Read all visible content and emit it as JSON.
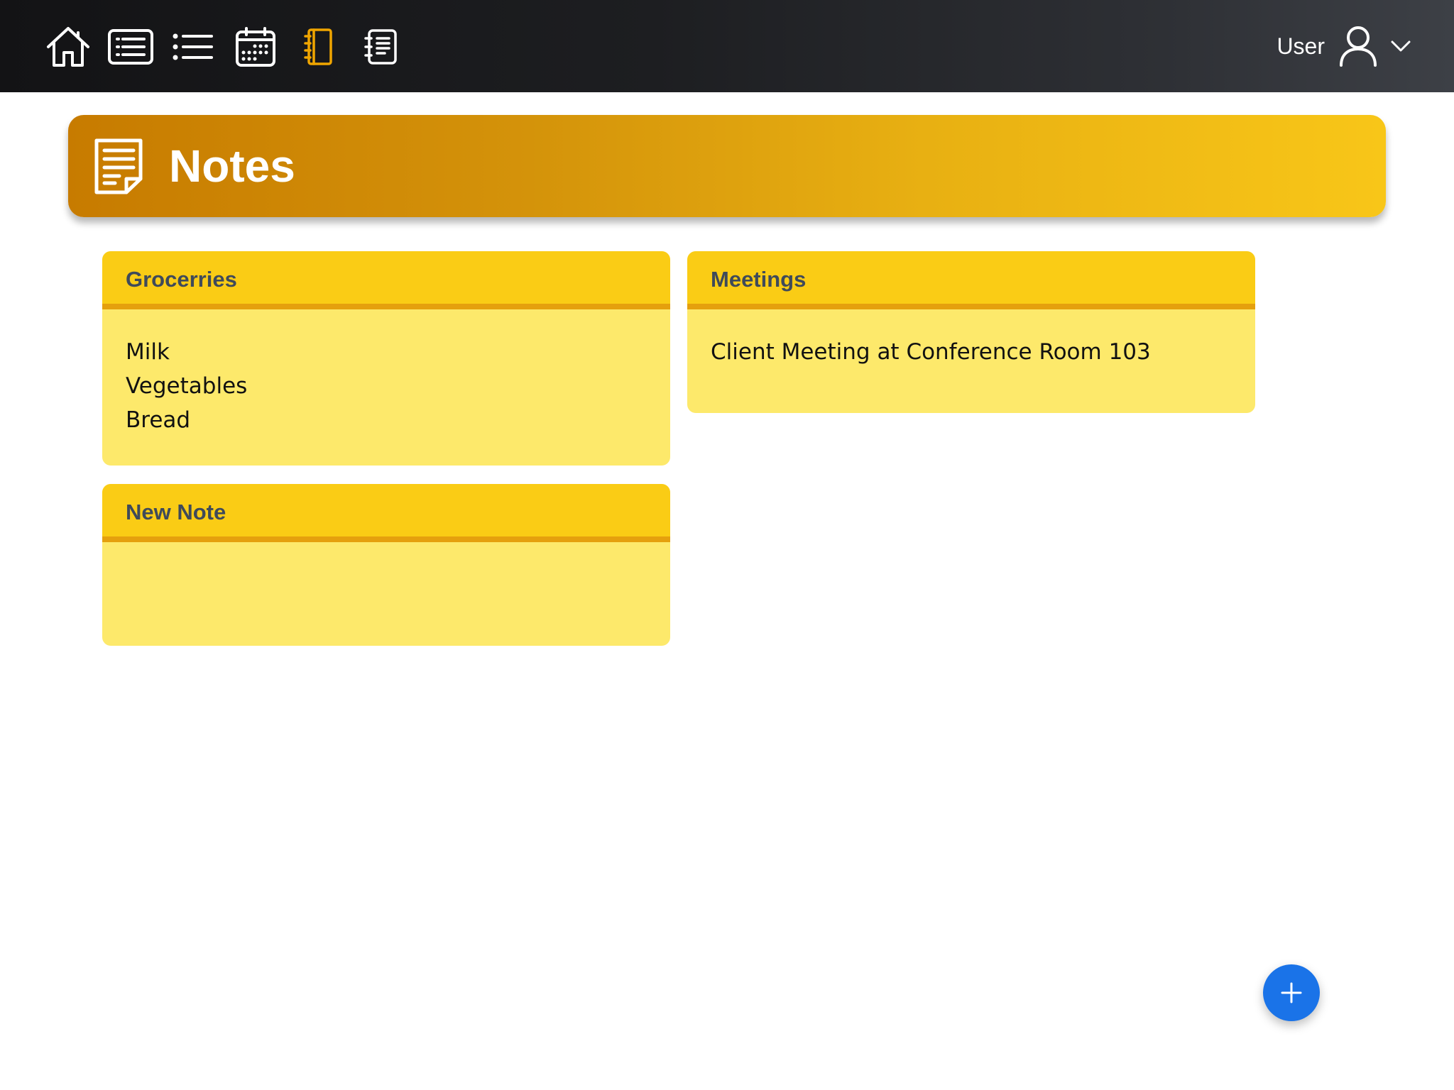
{
  "topbar": {
    "nav_icons": [
      {
        "name": "home-icon"
      },
      {
        "name": "list-box-icon"
      },
      {
        "name": "bullet-list-icon"
      },
      {
        "name": "calendar-icon"
      },
      {
        "name": "notebook-icon",
        "active": true
      },
      {
        "name": "notes-page-icon"
      }
    ],
    "active_color": "#f0a500",
    "user": {
      "label": "User",
      "avatar_icon": "user-icon",
      "menu_icon": "chevron-down-icon"
    }
  },
  "banner": {
    "icon": "note-document-icon",
    "title": "Notes",
    "gradient_start": "#c77b00",
    "gradient_end": "#f8c618"
  },
  "notes": [
    {
      "title": "Grocerries",
      "lines": [
        "Milk",
        "Vegetables",
        "Bread"
      ]
    },
    {
      "title": "Meetings",
      "lines": [
        "Client Meeting at Conference Room 103"
      ]
    },
    {
      "title": "New Note",
      "lines": []
    }
  ],
  "fab": {
    "icon": "plus-icon",
    "color": "#1a73e8"
  }
}
